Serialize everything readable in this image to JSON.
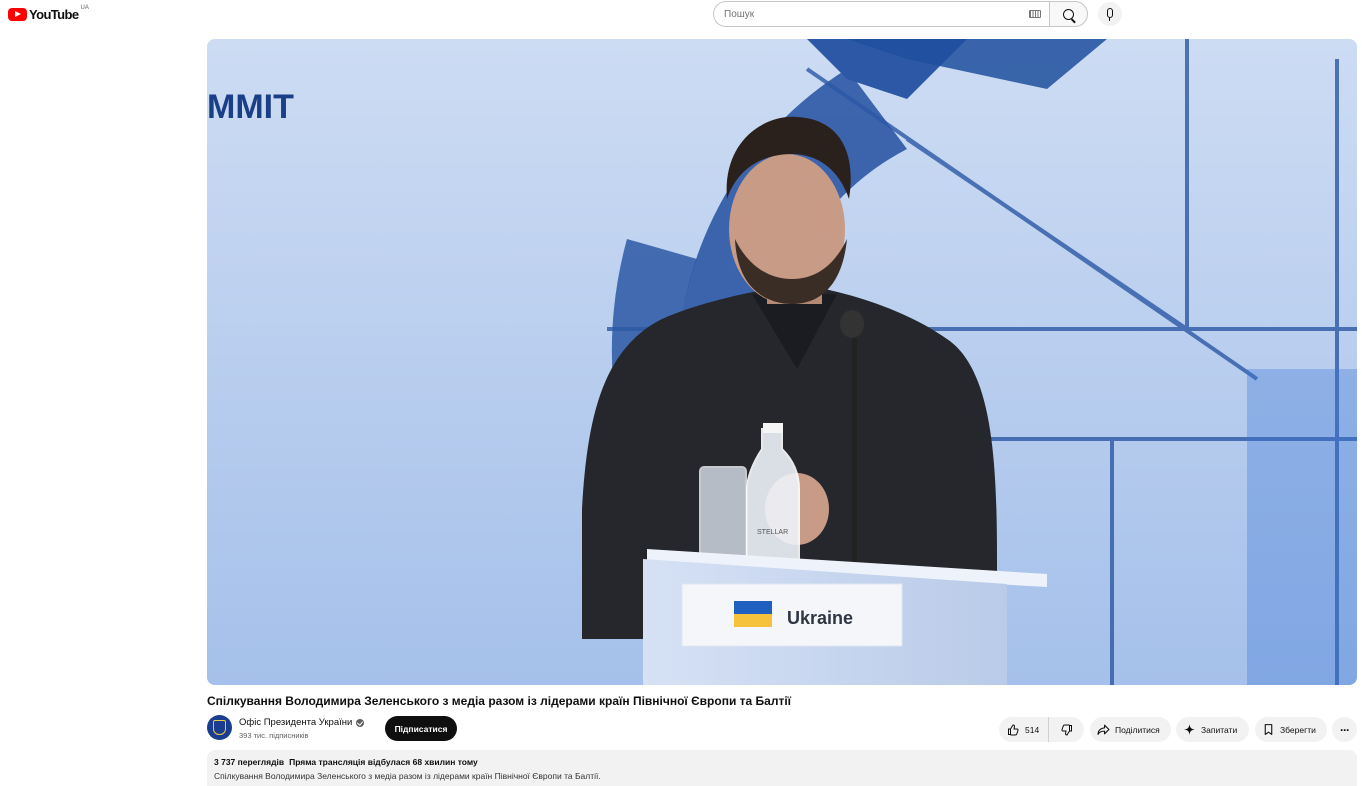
{
  "header": {
    "logo_text": "YouTube",
    "region": "UA",
    "search_placeholder": "Пошук"
  },
  "video": {
    "backdrop_text": "MMIT",
    "nameplate_text": "Ukraine",
    "bottle_label": "STELLAR",
    "colors": {
      "backdrop_blue": "#b7cdee",
      "accent_dark_blue": "#2d5aa8",
      "jacket": "#25272d"
    }
  },
  "title": "Спілкування Володимира Зеленського з медіа разом із лідерами країн Північної Європи та Балтії",
  "channel": {
    "name": "Офіс Президента України",
    "subscribers": "393 тис. підписників",
    "subscribe_label": "Підписатися"
  },
  "actions": {
    "like_count": "514",
    "share_label": "Поділитися",
    "ask_label": "Запитати",
    "save_label": "Зберегти",
    "more_label": "···"
  },
  "description": {
    "views": "3 737 переглядів",
    "streamed": "Пряма трансляція відбулася 68 хвилин тому",
    "text": "Спілкування Володимира Зеленського з медіа разом із лідерами країн Північної Європи та Балтії."
  },
  "colors": {
    "brand_red": "#ff0000",
    "chip_bg": "#f2f2f2",
    "text_primary": "#0f0f0f",
    "text_secondary": "#606060"
  }
}
